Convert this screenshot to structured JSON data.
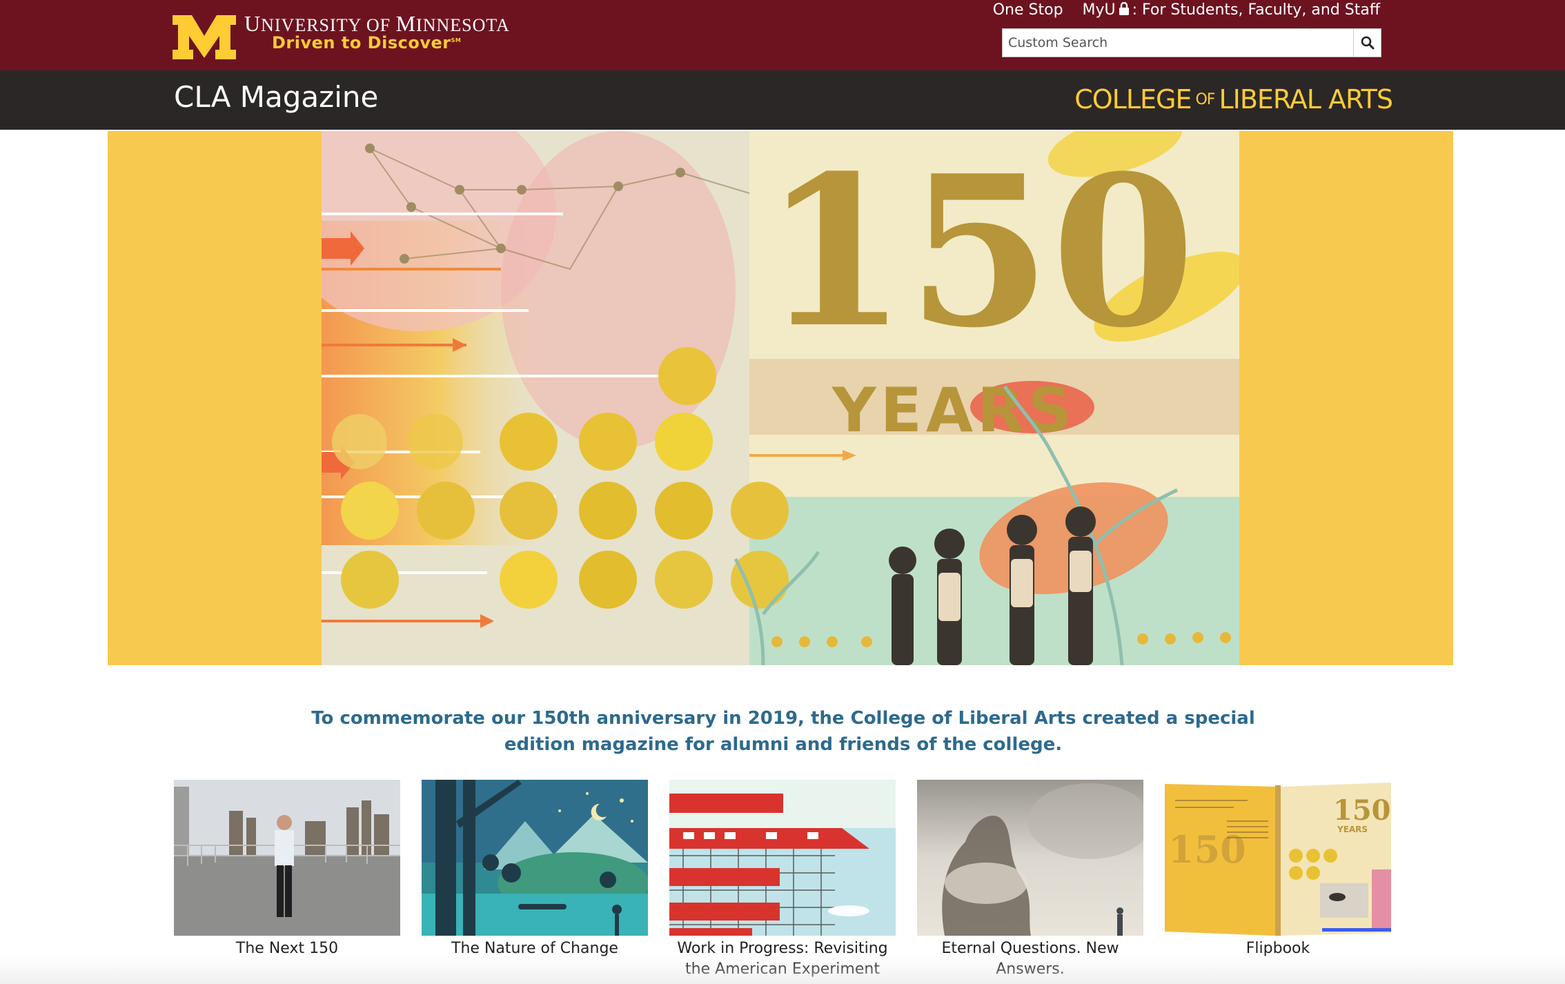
{
  "header": {
    "university_name_first_letter_1": "U",
    "university_name_rest_1": "NIVERSITY OF ",
    "university_name_first_letter_2": "M",
    "university_name_rest_2": "INNESOTA",
    "tagline": "Driven to Discover",
    "tagline_mark": "SM",
    "links": {
      "one_stop": "One Stop",
      "myu": "MyU",
      "myu_suffix": ": For Students, Faculty, and Staff"
    },
    "search": {
      "placeholder": "Custom Search",
      "icon": "search-icon"
    }
  },
  "subheader": {
    "site_title": "CLA Magazine",
    "college_part1": "COLLEGE",
    "college_of": "OF",
    "college_part2": "LIBERAL ARTS"
  },
  "hero": {
    "big_number": "150",
    "years_word": "YEARS"
  },
  "intro": {
    "text": "To commemorate our 150th anniversary in 2019, the College of Liberal Arts created a special edition magazine for alumni and friends of the college."
  },
  "cards": [
    {
      "label": "The Next 150"
    },
    {
      "label": "The Nature of Change"
    },
    {
      "label": "Work in Progress: Revisiting the American Experiment"
    },
    {
      "label": "Eternal Questions. New Answers."
    },
    {
      "label": "Flipbook"
    }
  ],
  "flipbook_thumb": {
    "number": "150",
    "word": "YEARS"
  },
  "colors": {
    "maroon": "#6d1320",
    "gold": "#ffcc33",
    "dark_bar": "#2b2727",
    "hero_bg": "#f8c94f",
    "intro_text": "#2d6a8e"
  }
}
